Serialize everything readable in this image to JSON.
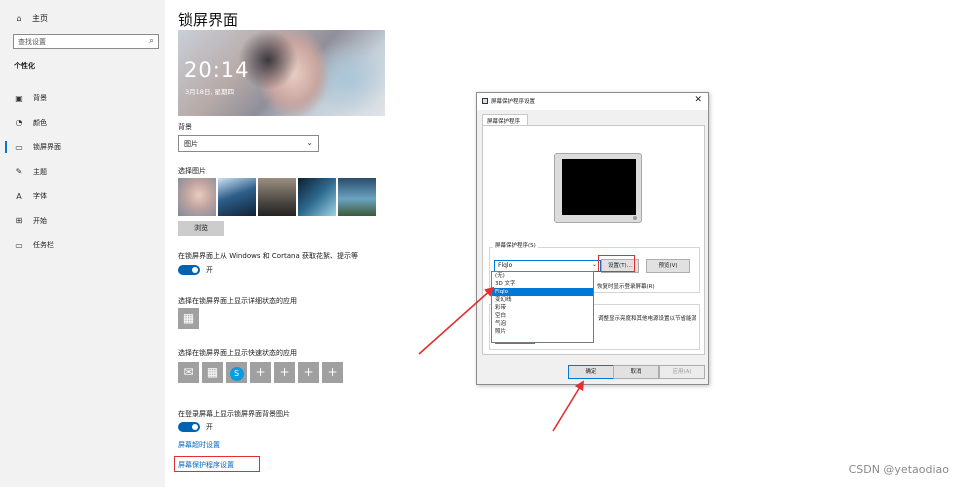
{
  "sidebar": {
    "home_label": "主页",
    "search_placeholder": "查找设置",
    "section_label": "个性化",
    "items": [
      {
        "label": "背景",
        "icon": "picture-icon"
      },
      {
        "label": "颜色",
        "icon": "palette-icon"
      },
      {
        "label": "锁屏界面",
        "icon": "lock-screen-icon",
        "active": true
      },
      {
        "label": "主题",
        "icon": "brush-icon"
      },
      {
        "label": "字体",
        "icon": "font-icon"
      },
      {
        "label": "开始",
        "icon": "start-icon"
      },
      {
        "label": "任务栏",
        "icon": "taskbar-icon"
      }
    ]
  },
  "main": {
    "title": "锁屏界面",
    "preview": {
      "time": "20:14",
      "date": "3月18日, 星期四"
    },
    "background_label": "背景",
    "background_value": "图片",
    "choose_picture_label": "选择图片",
    "browse_label": "浏览",
    "tips_label": "在锁屏界面上从 Windows 和 Cortana 获取花絮、提示等",
    "tips_toggle": "开",
    "detail_app_label": "选择在锁屏界面上显示详细状态的应用",
    "quick_app_label": "选择在锁屏界面上显示快速状态的应用",
    "signin_bg_label": "在登录屏幕上显示锁屏界面背景图片",
    "signin_toggle": "开",
    "cortana_link": "屏幕超时设置",
    "screensaver_link": "屏幕保护程序设置"
  },
  "dialog": {
    "title": "屏幕保护程序设置",
    "close_glyph": "✕",
    "tab_label": "屏幕保护程序",
    "group_label": "屏幕保护程序(S)",
    "selected": "Flqlo",
    "settings_btn": "设置(T)...",
    "preview_btn": "预览(V)",
    "checkbox_text": "恢复时显示登录屏幕(R)",
    "power_text": "调整显示亮度和其他电源设置以节省能源或提供最佳性能。",
    "options": [
      "(无)",
      "3D 文字",
      "Flqlo",
      "变幻线",
      "彩带",
      "空白",
      "气泡",
      "照片"
    ],
    "ok": "确定",
    "cancel": "取消",
    "apply": "应用(A)"
  },
  "watermark": "CSDN @yetaodiao",
  "colors": {
    "accent": "#0078d4",
    "annotation": "#e23030"
  }
}
